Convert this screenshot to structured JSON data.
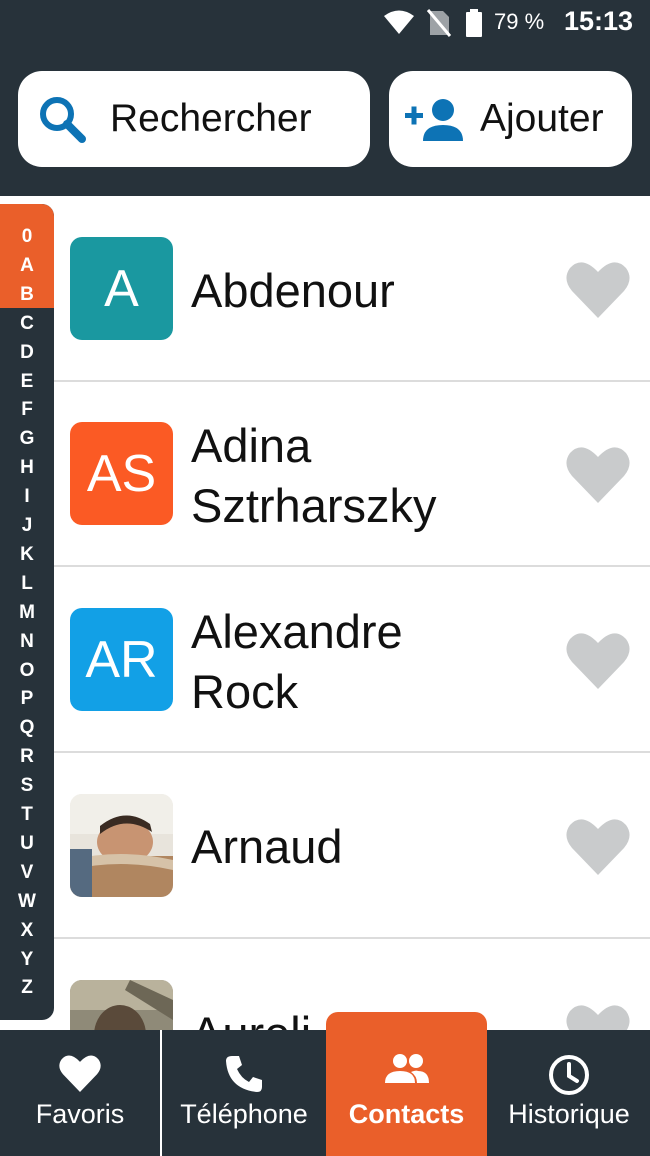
{
  "status_bar": {
    "battery_percent": "79 %",
    "time": "15:13",
    "icons": [
      "wifi-icon",
      "no-sim-icon",
      "battery-icon"
    ]
  },
  "header": {
    "search": {
      "label": "Rechercher",
      "icon": "search-icon"
    },
    "add": {
      "label": "Ajouter",
      "icon": "add-person-icon"
    }
  },
  "index": {
    "letters": [
      "0",
      "A",
      "B",
      "C",
      "D",
      "E",
      "F",
      "G",
      "H",
      "I",
      "J",
      "K",
      "L",
      "M",
      "N",
      "O",
      "P",
      "Q",
      "R",
      "S",
      "T",
      "U",
      "V",
      "W",
      "X",
      "Y",
      "Z"
    ],
    "highlighted": [
      "0",
      "A",
      "B"
    ],
    "highlight_color": "#ea5f2a"
  },
  "contacts": [
    {
      "name": "Abdenour",
      "initials": "A",
      "avatar_color": "#1a98a0",
      "favorite": false
    },
    {
      "name": "Adina\nSztrharszky",
      "initials": "AS",
      "avatar_color": "#fb5a24",
      "favorite": false
    },
    {
      "name": "Alexandre\nRock",
      "initials": "AR",
      "avatar_color": "#12a0e6",
      "favorite": false
    },
    {
      "name": "Arnaud",
      "initials": "",
      "avatar_type": "photo",
      "favorite": false
    },
    {
      "name": "Aureli",
      "initials": "",
      "avatar_type": "photo",
      "favorite": false
    }
  ],
  "bottom_nav": {
    "active": "Contacts",
    "accent": "#ea5f2a",
    "tabs": [
      {
        "label": "Favoris",
        "icon": "heart-icon"
      },
      {
        "label": "Téléphone",
        "icon": "phone-icon"
      },
      {
        "label": "Contacts",
        "icon": "people-icon"
      },
      {
        "label": "Historique",
        "icon": "clock-icon"
      }
    ]
  }
}
